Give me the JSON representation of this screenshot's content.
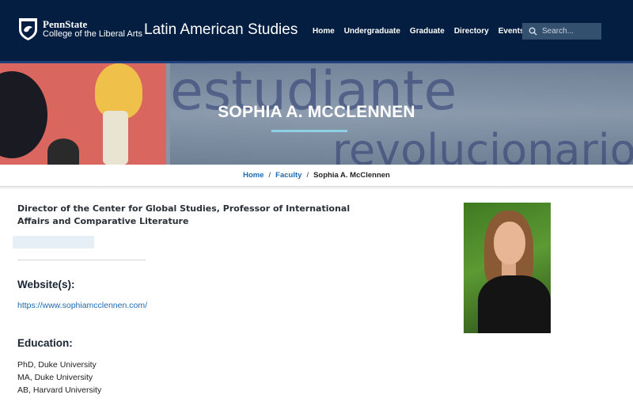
{
  "header": {
    "logo_line1": "PennState",
    "logo_line2": "College of the Liberal Arts",
    "site_title": "Latin American Studies",
    "nav": [
      "Home",
      "Undergraduate",
      "Graduate",
      "Directory",
      "Events"
    ],
    "search_placeholder": "Search..."
  },
  "hero": {
    "title": "SOPHIA A. MCCLENNEN",
    "background_text_1": "estudiante",
    "background_text_2": "revolucionario"
  },
  "breadcrumb": {
    "items": [
      "Home",
      "Faculty"
    ],
    "current": "Sophia A. McClennen"
  },
  "profile": {
    "job_title": "Director of the Center for Global Studies, Professor of International Affairs and Comparative Literature",
    "website_heading": "Website(s):",
    "website_url": "https://www.sophiamcclennen.com/",
    "education_heading": "Education:",
    "education": [
      "PhD, Duke University",
      "MA, Duke University",
      "AB, Harvard University"
    ]
  },
  "colors": {
    "header_bg": "#041e42",
    "link": "#1e6ab0",
    "accent_underline": "#8ed0e6"
  },
  "icons": [
    "penn-state-shield-icon",
    "search-icon"
  ]
}
